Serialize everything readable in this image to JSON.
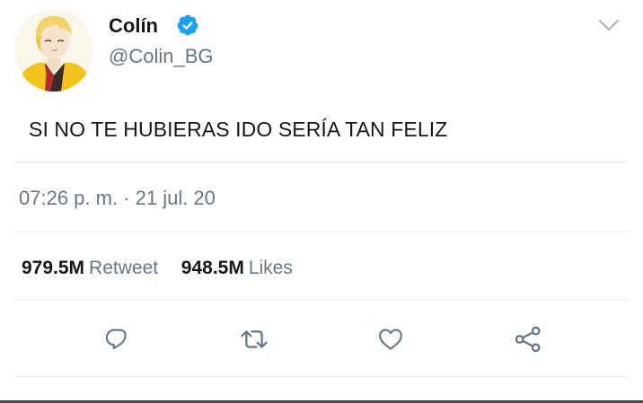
{
  "tweet": {
    "user": {
      "name": "Colín",
      "handle": "@Colin_BG",
      "verified": true
    },
    "text": "SI NO TE HUBIERAS IDO SERÍA TAN FELIZ",
    "timestamp": "07:26 p. m. · 21 jul. 20",
    "stats": {
      "retweets_count": "979.5M",
      "retweets_label": "Retweet",
      "likes_count": "948.5M",
      "likes_label": "Likes"
    },
    "actions": [
      {
        "icon": "reply-icon"
      },
      {
        "icon": "retweet-icon"
      },
      {
        "icon": "like-icon"
      },
      {
        "icon": "share-icon"
      }
    ],
    "colors": {
      "text": "#14171a",
      "secondary": "#657786",
      "verified": "#1da1f2",
      "divider": "#e6ecf0"
    }
  }
}
